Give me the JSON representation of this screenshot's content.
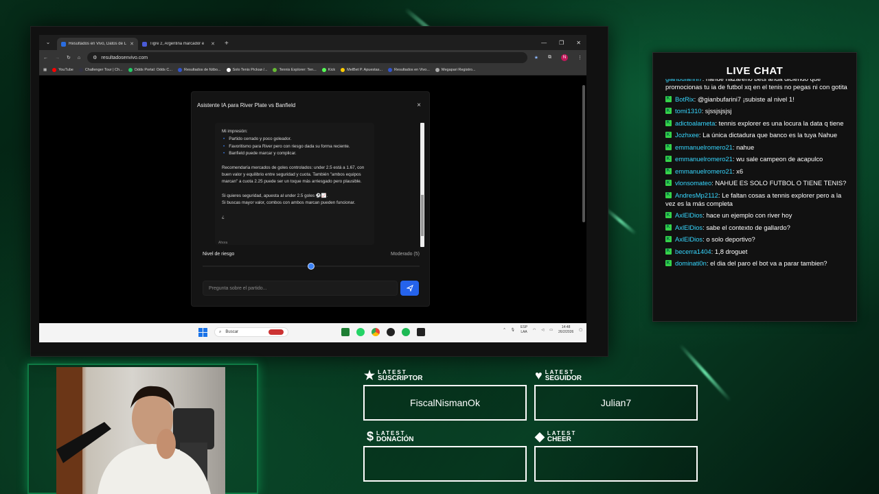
{
  "browser": {
    "tabs": [
      {
        "title": "Resultados en Vivo, Datos de L",
        "active": true,
        "favicon_color": "#2a6de0"
      },
      {
        "title": "Tigre 2, Argentina marcador e",
        "active": false,
        "favicon_color": "#4a5bd6"
      }
    ],
    "url": "resultadosenvivo.com",
    "bookmarks": [
      "YouTube",
      "Challenger Tour | Ch...",
      "Odds Portal: Odds C...",
      "Resultados de fútbo...",
      "Solo Tenis Picksø /...",
      "Tennis Explorer: Ten...",
      "Kick",
      "MelBet P. Apuestas...",
      "Resultados en Vivo...",
      "Megapari Registro..."
    ],
    "avatar_letter": "N"
  },
  "modal": {
    "title": "Asistente IA para River Plate vs Banfield",
    "close": "×",
    "impression_heading": "Mi impresión:",
    "bullets": [
      "Partido cerrado y poco goleador.",
      "Favoritismo para River pero con riesgo dada su forma reciente.",
      "Banfield puede marcar y complicar."
    ],
    "recommendation": "Recomendaría mercados de goles controlados: under 2.5 está a 1.67, con buen valor y equilibrio entre seguridad y cuota. También \"ambos equipos marcan\" a cuota 2.25 puede ser un toque más arriesgado pero plausible.",
    "safety_line1": "Si quieres seguridad, apuesta al under 2.5 goles ⚽📈.",
    "safety_line2": "Si buscas mayor valor, combos con ambos marcan pueden funcionar.",
    "trail": "¿",
    "timestamp": "Ahora",
    "risk_label": "Nivel de riesgo",
    "risk_value": "Moderado (5)",
    "risk_level": 0.5,
    "input_placeholder": "Pregunta sobre el partido..."
  },
  "taskbar": {
    "search_placeholder": "Buscar",
    "lang_top": "ESP",
    "lang_bottom": "LAA",
    "time": "14:48",
    "date": "26/2/2026"
  },
  "chat": {
    "title": "LIVE CHAT",
    "messages": [
      {
        "user": "gianbufarini7",
        "text": "nahue nazareno bets anda diciendo que promocionas tu ia de futbol xq en el tenis no pegas ni con gotita",
        "badge": false
      },
      {
        "user": "BotRix",
        "text": "@gianbufarini7 ¡subiste al nivel 1!",
        "badge": true
      },
      {
        "user": "tomi1310",
        "text": "sjssjsjsjsj",
        "badge": true
      },
      {
        "user": "adictoalameta",
        "text": "tennis explorer es una locura la data q tiene",
        "badge": true
      },
      {
        "user": "Jozhxee",
        "text": "La única dictadura que banco es la tuya Nahue",
        "badge": true
      },
      {
        "user": "emmanuelromero21",
        "text": "nahue",
        "badge": true
      },
      {
        "user": "emmanuelromero21",
        "text": "wu sale campeon de acapulco",
        "badge": true
      },
      {
        "user": "emmanuelromero21",
        "text": "x6",
        "badge": true
      },
      {
        "user": "vlonsomateo",
        "text": "NAHUE ES SOLO FUTBOL O TIENE TENIS?",
        "badge": true
      },
      {
        "user": "AndresMp2112",
        "text": "Le faltan cosas a tennis explorer pero a la vez es la más completa",
        "badge": true
      },
      {
        "user": "AxlElDios",
        "text": "hace un ejemplo con river hoy",
        "badge": true
      },
      {
        "user": "AxlElDios",
        "text": "sabe el contexto de gallardo?",
        "badge": true
      },
      {
        "user": "AxlElDios",
        "text": "o solo deportivo?",
        "badge": true
      },
      {
        "user": "becerra1404",
        "text": "1,8 droguet",
        "badge": true
      },
      {
        "user": "dominati0n",
        "text": "el dia del paro el bot va a parar tambien?",
        "badge": true
      }
    ]
  },
  "stats": {
    "suscriptor": {
      "small": "LATEST",
      "big": "SUSCRIPTOR",
      "value": "FiscalNismanOk"
    },
    "seguidor": {
      "small": "LATEST",
      "big": "SEGUIDOR",
      "value": "Julian7"
    },
    "donacion": {
      "small": "LATEST",
      "big": "DONACIÓN",
      "value": ""
    },
    "cheer": {
      "small": "LATEST",
      "big": "CHEER",
      "value": ""
    }
  }
}
